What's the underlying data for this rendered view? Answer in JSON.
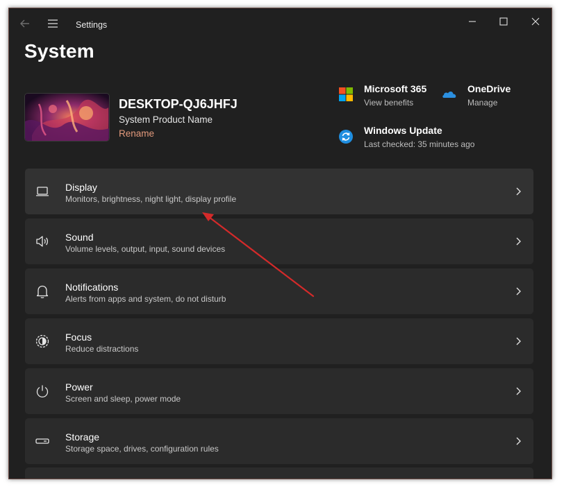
{
  "window": {
    "app_title": "Settings",
    "page_title": "System"
  },
  "device": {
    "name": "DESKTOP-QJ6JHFJ",
    "model": "System Product Name",
    "rename_label": "Rename"
  },
  "tiles": [
    {
      "title": "Microsoft 365",
      "subtitle": "View benefits",
      "icon": "microsoft-365-icon"
    },
    {
      "title": "OneDrive",
      "subtitle": "Manage",
      "icon": "onedrive-icon"
    },
    {
      "title": "Windows Update",
      "subtitle": "Last checked: 35 minutes ago",
      "icon": "windows-update-icon"
    }
  ],
  "cards": [
    {
      "title": "Display",
      "subtitle": "Monitors, brightness, night light, display profile",
      "icon": "display-icon"
    },
    {
      "title": "Sound",
      "subtitle": "Volume levels, output, input, sound devices",
      "icon": "sound-icon"
    },
    {
      "title": "Notifications",
      "subtitle": "Alerts from apps and system, do not disturb",
      "icon": "bell-icon"
    },
    {
      "title": "Focus",
      "subtitle": "Reduce distractions",
      "icon": "focus-icon"
    },
    {
      "title": "Power",
      "subtitle": "Screen and sleep, power mode",
      "icon": "power-icon"
    },
    {
      "title": "Storage",
      "subtitle": "Storage space, drives, configuration rules",
      "icon": "storage-icon"
    }
  ],
  "colors": {
    "window_bg": "#202020",
    "card_bg": "#2b2b2b",
    "accent_rename": "#e39a7c",
    "annotation_arrow": "#d42a2a"
  }
}
